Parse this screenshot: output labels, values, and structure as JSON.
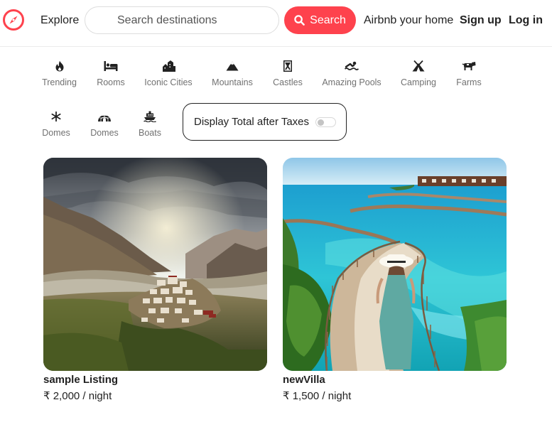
{
  "navbar": {
    "explore_label": "Explore",
    "search_placeholder": "Search destinations",
    "search_button_label": "Search",
    "host_label": "Airbnb your home",
    "signup_label": "Sign up",
    "login_label": "Log in"
  },
  "filters": [
    {
      "label": "Trending",
      "icon": "fire-icon"
    },
    {
      "label": "Rooms",
      "icon": "bed-icon"
    },
    {
      "label": "Iconic Cities",
      "icon": "city-icon"
    },
    {
      "label": "Mountains",
      "icon": "mountain-icon"
    },
    {
      "label": "Castles",
      "icon": "castle-icon"
    },
    {
      "label": "Amazing Pools",
      "icon": "swimmer-icon"
    },
    {
      "label": "Camping",
      "icon": "tent-icon"
    },
    {
      "label": "Farms",
      "icon": "cow-icon"
    },
    {
      "label": "Domes",
      "icon": "snowflake-icon"
    },
    {
      "label": "Domes",
      "icon": "igloo-icon"
    },
    {
      "label": "Boats",
      "icon": "ship-icon"
    }
  ],
  "tax_toggle": {
    "label": "Display Total after Taxes",
    "on": false
  },
  "listings": [
    {
      "title": "sample Listing",
      "price": "₹ 2,000 / night",
      "image": "mountain-monastery-photo"
    },
    {
      "title": "newVilla",
      "price": "₹ 1,500 / night",
      "image": "tropical-boardwalk-photo"
    }
  ],
  "colors": {
    "brand": "#fe424d",
    "text": "#222222",
    "muted": "#717171"
  }
}
